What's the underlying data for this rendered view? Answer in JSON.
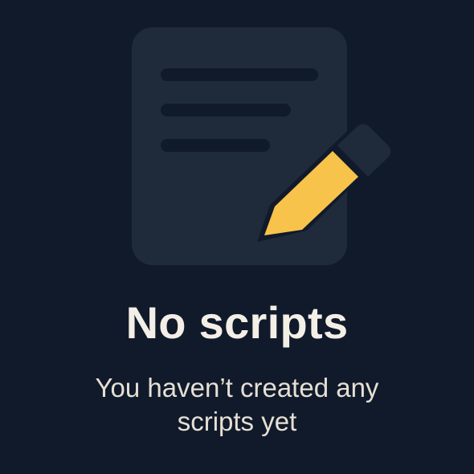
{
  "empty_state": {
    "icon": "document-with-pencil-icon",
    "title": "No scripts",
    "message": "You haven’t created any scripts yet"
  },
  "colors": {
    "background": "#111a2b",
    "document": "#1f2a3a",
    "document_lines": "#111a2b",
    "pencil": "#f8c34a",
    "text": "#f3efe6"
  }
}
